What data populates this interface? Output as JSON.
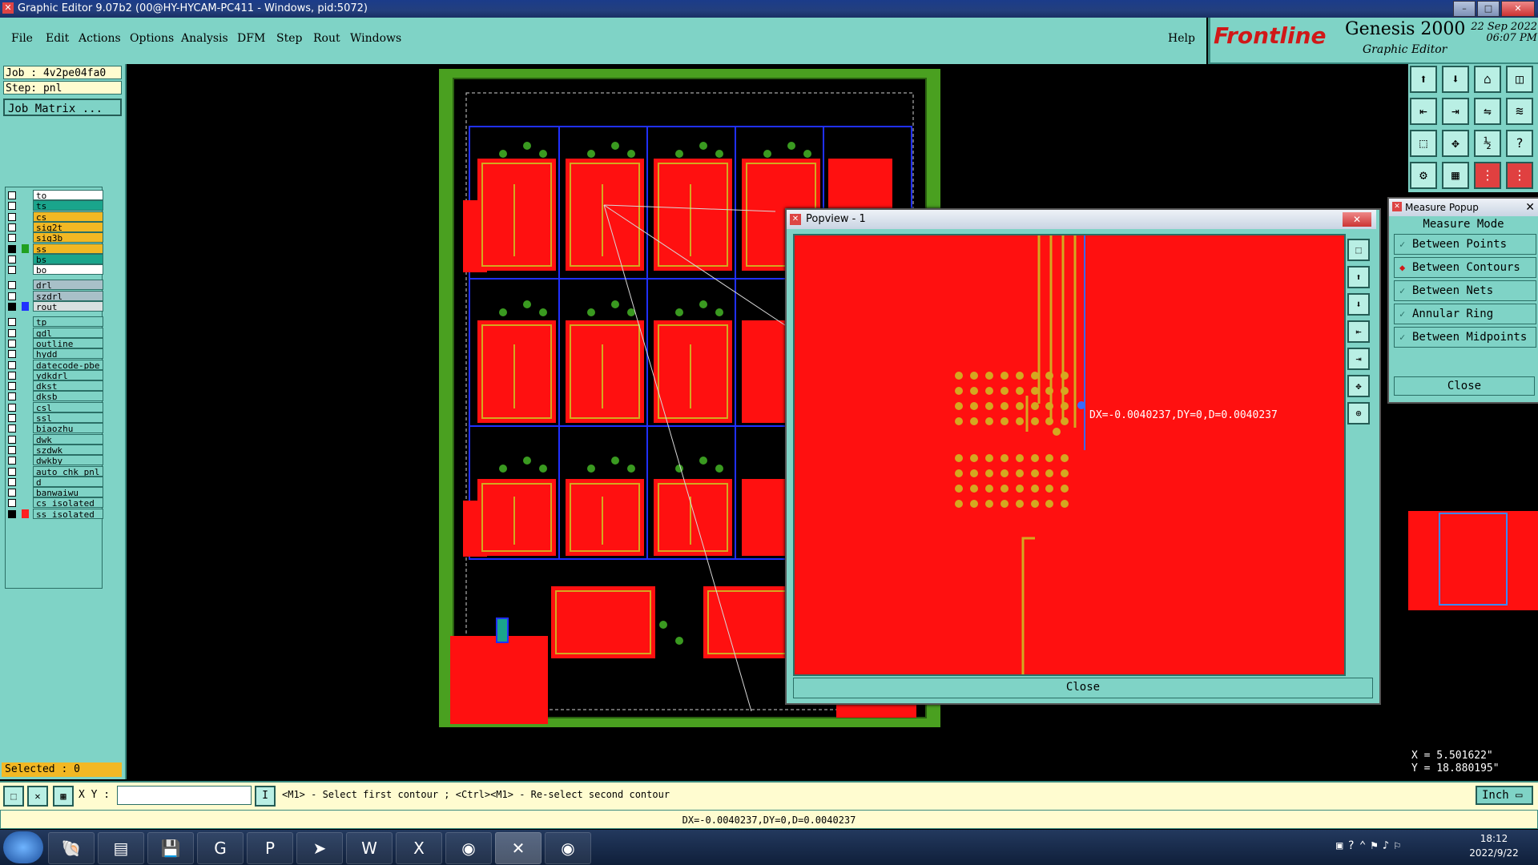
{
  "window": {
    "title": "Graphic Editor 9.07b2 (00@HY-HYCAM-PC411 - Windows, pid:5072)"
  },
  "menu": [
    "File",
    "Edit",
    "Actions",
    "Options",
    "Analysis",
    "DFM",
    "Step",
    "Rout",
    "Windows"
  ],
  "help": "Help",
  "brand": {
    "logo": "Frontline",
    "product": "Genesis 2000",
    "subtitle": "Graphic Editor",
    "date": "22 Sep 2022",
    "time": "06:07 PM"
  },
  "job": {
    "job_label": "Job : 4v2pe04fa0",
    "step_label": "Step: pnl",
    "matrix_button": "Job Matrix ...",
    "selected": "Selected : 0"
  },
  "layers": [
    {
      "name": "to",
      "color": "#ffffff",
      "swatch": ""
    },
    {
      "name": "ts",
      "color": "#1aa58c",
      "swatch": ""
    },
    {
      "name": "cs",
      "color": "#f2b824",
      "swatch": ""
    },
    {
      "name": "sig2t",
      "color": "#f2b824",
      "swatch": ""
    },
    {
      "name": "sig3b",
      "color": "#f2b824",
      "swatch": ""
    },
    {
      "name": "ss",
      "color": "#f2b824",
      "swatch": "#20a020"
    },
    {
      "name": "bs",
      "color": "#1aa58c",
      "swatch": ""
    },
    {
      "name": "bo",
      "color": "#ffffff",
      "swatch": ""
    },
    {
      "name": "drl",
      "color": "#a8c0c8",
      "swatch": ""
    },
    {
      "name": "szdrl",
      "color": "#a8c0c8",
      "swatch": ""
    },
    {
      "name": "rout",
      "color": "#d8e0e0",
      "swatch": "#2030ff"
    },
    {
      "name": "tp",
      "color": "#7fd3c6",
      "swatch": ""
    },
    {
      "name": "gdl",
      "color": "#7fd3c6",
      "swatch": ""
    },
    {
      "name": "outline",
      "color": "#7fd3c6",
      "swatch": ""
    },
    {
      "name": "hydd",
      "color": "#7fd3c6",
      "swatch": ""
    },
    {
      "name": "datecode-pbe",
      "color": "#7fd3c6",
      "swatch": ""
    },
    {
      "name": "ydkdrl",
      "color": "#7fd3c6",
      "swatch": ""
    },
    {
      "name": "dkst",
      "color": "#7fd3c6",
      "swatch": ""
    },
    {
      "name": "dksb",
      "color": "#7fd3c6",
      "swatch": ""
    },
    {
      "name": "csl",
      "color": "#7fd3c6",
      "swatch": ""
    },
    {
      "name": "ssl",
      "color": "#7fd3c6",
      "swatch": ""
    },
    {
      "name": "biaozhu",
      "color": "#7fd3c6",
      "swatch": ""
    },
    {
      "name": "dwk",
      "color": "#7fd3c6",
      "swatch": ""
    },
    {
      "name": "szdwk",
      "color": "#7fd3c6",
      "swatch": ""
    },
    {
      "name": "dwkby",
      "color": "#7fd3c6",
      "swatch": ""
    },
    {
      "name": "auto_chk_pnl",
      "color": "#7fd3c6",
      "swatch": ""
    },
    {
      "name": "d",
      "color": "#7fd3c6",
      "swatch": ""
    },
    {
      "name": "banwaiwu",
      "color": "#7fd3c6",
      "swatch": ""
    },
    {
      "name": "cs_isolated",
      "color": "#7fd3c6",
      "swatch": ""
    },
    {
      "name": "ss_isolated",
      "color": "#7fd3c6",
      "swatch": "#ff2020"
    }
  ],
  "popview": {
    "title": "Popview - 1",
    "measure_text": "DX=-0.0040237,DY=0,D=0.0040237",
    "close": "Close"
  },
  "measure_popup": {
    "title": "Measure Popup",
    "mode_label": "Measure Mode",
    "options": [
      {
        "label": "Between Points",
        "selected": false
      },
      {
        "label": "Between Contours",
        "selected": true
      },
      {
        "label": "Between Nets",
        "selected": false
      },
      {
        "label": "Annular Ring",
        "selected": false
      },
      {
        "label": "Between Midpoints",
        "selected": false
      }
    ],
    "close": "Close"
  },
  "coords": {
    "x": "X = 5.501622\"",
    "y": "Y = 18.880195\""
  },
  "bottom": {
    "xy_label": "X Y :",
    "xy_value": "",
    "prompt": "<M1> - Select first contour ; <Ctrl><M1> - Re-select second contour",
    "units": "Inch"
  },
  "status": "DX=-0.0040237,DY=0,D=0.0040237",
  "taskbar": {
    "time": "18:12",
    "date": "2022/9/22"
  },
  "colors": {
    "panel": "#7fd3c6",
    "copper": "#ff0000",
    "pad": "#d4a820",
    "board": "#4aa020",
    "outline": "#2030ff"
  }
}
